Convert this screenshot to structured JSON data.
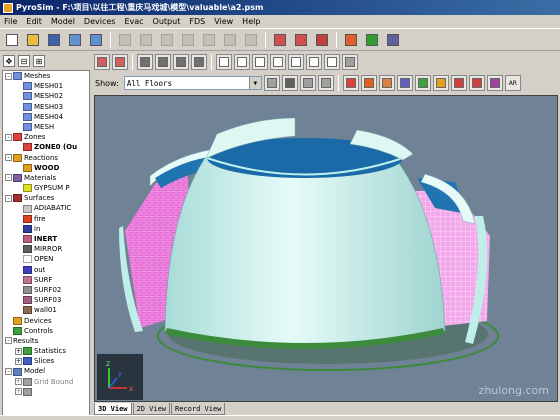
{
  "title": "PyroSim - F:\\项目\\以往工程\\重庆马戏城\\模型\\valuable\\a2.psm",
  "menu": [
    "File",
    "Edit",
    "Model",
    "Devices",
    "Evac",
    "Output",
    "FDS",
    "View",
    "Help"
  ],
  "toolbar": {
    "buttons": [
      {
        "name": "new-icon",
        "color": "#ffffff",
        "enabled": true
      },
      {
        "name": "open-icon",
        "color": "#e8c040",
        "enabled": true
      },
      {
        "name": "save-icon",
        "color": "#4060b0",
        "enabled": true
      },
      {
        "name": "import-icon",
        "color": "#6090d0",
        "enabled": true
      },
      {
        "name": "export-icon",
        "color": "#6090d0",
        "enabled": true
      },
      {
        "name": "undo-icon",
        "color": "#a0a0a0",
        "enabled": false
      },
      {
        "name": "redo-icon",
        "color": "#a0a0a0",
        "enabled": false
      },
      {
        "name": "cut-icon",
        "color": "#a0a0a0",
        "enabled": false
      },
      {
        "name": "copy-icon",
        "color": "#a0a0a0",
        "enabled": false
      },
      {
        "name": "paste-icon",
        "color": "#a0a0a0",
        "enabled": false
      },
      {
        "name": "delete-icon",
        "color": "#a0a0a0",
        "enabled": false
      },
      {
        "name": "properties-icon",
        "color": "#a0a0a0",
        "enabled": false
      },
      {
        "name": "run-fds-icon",
        "color": "#d05050",
        "enabled": true
      },
      {
        "name": "run-parallel-icon",
        "color": "#d05050",
        "enabled": true
      },
      {
        "name": "smokeview-icon",
        "color": "#c04040",
        "enabled": true
      },
      {
        "name": "flame-icon",
        "color": "#e06030",
        "enabled": true
      },
      {
        "name": "evac-icon",
        "color": "#30a030",
        "enabled": true
      },
      {
        "name": "settings-icon",
        "color": "#6060a0",
        "enabled": true
      }
    ]
  },
  "view_tools": [
    {
      "name": "view-front-icon",
      "color": "#d06060"
    },
    {
      "name": "view-back-icon",
      "color": "#d06060"
    },
    {
      "name": "solid-icon",
      "color": "#707070"
    },
    {
      "name": "outline-icon",
      "color": "#707070"
    },
    {
      "name": "smooth-icon",
      "color": "#707070"
    },
    {
      "name": "wire-icon",
      "color": "#707070"
    },
    {
      "name": "select-icon",
      "color": "#ffffff"
    },
    {
      "name": "orbit-icon",
      "color": "#ffffff"
    },
    {
      "name": "pan-icon",
      "color": "#ffffff"
    },
    {
      "name": "move-icon",
      "color": "#ffffff"
    },
    {
      "name": "zoom-icon",
      "color": "#ffffff"
    },
    {
      "name": "zoom-box-icon",
      "color": "#ffffff"
    },
    {
      "name": "reset-view-icon",
      "color": "#ffffff"
    },
    {
      "name": "fit-icon",
      "color": "#a0a0a0"
    }
  ],
  "show": {
    "label": "Show:",
    "value": "All Floors",
    "buttons": [
      {
        "name": "floor-1-icon",
        "color": "#a0a0a0"
      },
      {
        "name": "floor-2-icon",
        "color": "#606060"
      },
      {
        "name": "floor-3-icon",
        "color": "#a0a0a0"
      },
      {
        "name": "floor-4-icon",
        "color": "#a0a0a0"
      },
      {
        "name": "draw-obst-icon",
        "color": "#e04040"
      },
      {
        "name": "draw-hole-icon",
        "color": "#e06020"
      },
      {
        "name": "draw-vent-icon",
        "color": "#e08040"
      },
      {
        "name": "draw-room-icon",
        "color": "#6060c0"
      },
      {
        "name": "draw-wall-icon",
        "color": "#40a040"
      },
      {
        "name": "draw-fire-icon",
        "color": "#e0a020"
      },
      {
        "name": "draw-device-icon",
        "color": "#d04040"
      },
      {
        "name": "draw-sprinkler-icon",
        "color": "#d04040"
      },
      {
        "name": "draw-door-icon",
        "color": "#a040a0"
      },
      {
        "name": "ar-icon",
        "color": "#ffffff"
      }
    ],
    "ar_label": "AR"
  },
  "tree": [
    {
      "text": "Meshes",
      "indent": 0,
      "expander": "-",
      "icon": "mesh-group-icon",
      "color": "#7090e0",
      "bold": false
    },
    {
      "text": "MESH01",
      "indent": 1,
      "icon": "mesh-icon",
      "color": "#7090e0",
      "bold": false
    },
    {
      "text": "MESH02",
      "indent": 1,
      "icon": "mesh-icon",
      "color": "#7090e0",
      "bold": false
    },
    {
      "text": "MESH03",
      "indent": 1,
      "icon": "mesh-icon",
      "color": "#7090e0",
      "bold": false
    },
    {
      "text": "MESH04",
      "indent": 1,
      "icon": "mesh-icon",
      "color": "#7090e0",
      "bold": false
    },
    {
      "text": "MESH",
      "indent": 1,
      "icon": "mesh-icon",
      "color": "#7090e0",
      "bold": false
    },
    {
      "text": "Zones",
      "indent": 0,
      "expander": "-",
      "icon": "zones-icon",
      "color": "#e04040",
      "bold": false
    },
    {
      "text": "ZONE0 (Ou",
      "indent": 1,
      "icon": "zone-icon",
      "color": "#e04040",
      "bold": true
    },
    {
      "text": "Reactions",
      "indent": 0,
      "expander": "-",
      "icon": "reactions-icon",
      "color": "#e0a020",
      "bold": false
    },
    {
      "text": "WOOD",
      "indent": 1,
      "icon": "reaction-icon",
      "color": "#e0a020",
      "bold": true
    },
    {
      "text": "Materials",
      "indent": 0,
      "expander": "-",
      "icon": "materials-icon",
      "color": "#8060a0",
      "bold": false
    },
    {
      "text": "GYPSUM P",
      "indent": 1,
      "icon": "material-icon",
      "color": "#e0e020",
      "bold": false
    },
    {
      "text": "Surfaces",
      "indent": 0,
      "expander": "-",
      "icon": "surfaces-icon",
      "color": "#a03030",
      "bold": false
    },
    {
      "text": "ADIABATIC",
      "indent": 1,
      "icon": "surface-icon",
      "color": "#c8c8c8",
      "bold": false
    },
    {
      "text": "fire",
      "indent": 1,
      "icon": "surface-icon",
      "color": "#e04020",
      "bold": false
    },
    {
      "text": "in",
      "indent": 1,
      "icon": "surface-icon",
      "color": "#3040a0",
      "bold": false
    },
    {
      "text": "INERT",
      "indent": 1,
      "icon": "surface-icon",
      "color": "#c06080",
      "bold": true
    },
    {
      "text": "MIRROR",
      "indent": 1,
      "icon": "surface-icon",
      "color": "#606060",
      "bold": false
    },
    {
      "text": "OPEN",
      "indent": 1,
      "icon": "surface-icon",
      "color": "#ffffff",
      "bold": false
    },
    {
      "text": "out",
      "indent": 1,
      "icon": "surface-icon",
      "color": "#4040c0",
      "bold": false
    },
    {
      "text": "SURF",
      "indent": 1,
      "icon": "surface-icon",
      "color": "#c07090",
      "bold": false
    },
    {
      "text": "SURF02",
      "indent": 1,
      "icon": "surface-icon",
      "color": "#909090",
      "bold": false
    },
    {
      "text": "SURF03",
      "indent": 1,
      "icon": "surface-icon",
      "color": "#a06080",
      "bold": false
    },
    {
      "text": "wall01",
      "indent": 1,
      "icon": "surface-icon",
      "color": "#8a6a50",
      "bold": false
    },
    {
      "text": "Devices",
      "indent": 0,
      "icon": "devices-icon",
      "color": "#e0a020",
      "bold": false
    },
    {
      "text": "Controls",
      "indent": 0,
      "icon": "controls-icon",
      "color": "#40a040",
      "bold": false
    },
    {
      "text": "Results",
      "indent": 0,
      "expander": "-",
      "icon": "none",
      "color": "#ffffff",
      "bold": false
    },
    {
      "text": "Statistics",
      "indent": 1,
      "expander": "+",
      "icon": "statistics-icon",
      "color": "#40a040",
      "bold": false
    },
    {
      "text": "Slices",
      "indent": 1,
      "expander": "+",
      "icon": "slices-icon",
      "color": "#4060c0",
      "bold": false
    },
    {
      "text": "Model",
      "indent": 0,
      "expander": "-",
      "icon": "model-icon",
      "color": "#6080c0",
      "bold": false
    },
    {
      "text": "Grid Bound",
      "indent": 1,
      "expander": "+",
      "icon": "grid-icon",
      "color": "#a0a0a0",
      "bold": false,
      "gray": true
    },
    {
      "text": "",
      "indent": 1,
      "expander": "+",
      "icon": "grid-icon",
      "color": "#a0a0a0",
      "bold": false,
      "gray": true
    }
  ],
  "view_tabs": [
    {
      "label": "3D View",
      "active": true
    },
    {
      "label": "2D View",
      "active": false
    },
    {
      "label": "Record View",
      "active": false
    }
  ],
  "watermark": "zhulong.com",
  "colors": {
    "viewport_bg": "#6f8296",
    "dome": "#d8f6f2",
    "dome_top": "#1a6aa8",
    "panels": "#e66ad6",
    "ground": "#3c8a3c"
  }
}
